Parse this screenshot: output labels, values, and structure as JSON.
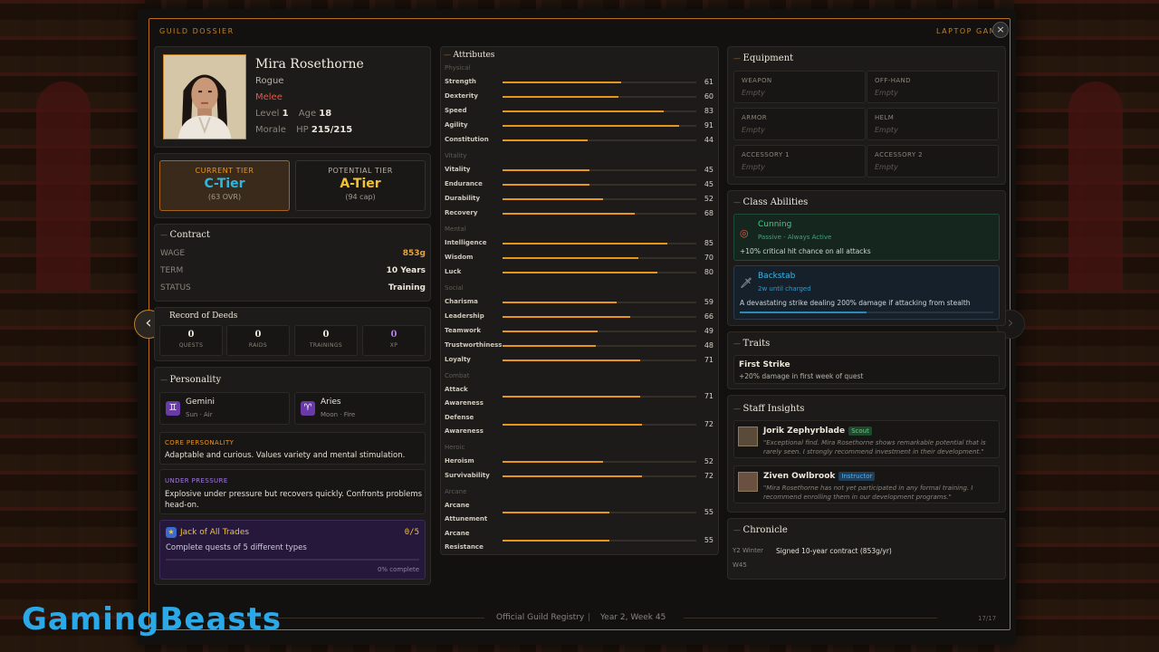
{
  "header": {
    "left": "GUILD DOSSIER",
    "right": "LAPTOP GAM",
    "close": "×"
  },
  "nav": {
    "prev": "‹",
    "next": "›"
  },
  "profile": {
    "name": "Mira Rosethorne",
    "class": "Rogue",
    "style": "Melee",
    "level_label": "Level",
    "level": "1",
    "age_label": "Age",
    "age": "18",
    "morale_label": "Morale",
    "hp_label": "HP",
    "hp": "215/215"
  },
  "tiers": {
    "current": {
      "label": "CURRENT TIER",
      "value": "C-Tier",
      "sub": "(63 OVR)"
    },
    "potential": {
      "label": "POTENTIAL TIER",
      "value": "A-Tier",
      "sub": "(94 cap)"
    }
  },
  "contract": {
    "title": "Contract",
    "rows": [
      {
        "label": "WAGE",
        "value": "853g"
      },
      {
        "label": "TERM",
        "value": "10 Years"
      },
      {
        "label": "STATUS",
        "value": "Training"
      }
    ]
  },
  "deeds": {
    "title": "Record of Deeds",
    "items": [
      {
        "value": "0",
        "label": "QUESTS"
      },
      {
        "value": "0",
        "label": "RAIDS"
      },
      {
        "value": "0",
        "label": "TRAININGS"
      },
      {
        "value": "0",
        "label": "XP"
      }
    ]
  },
  "personality": {
    "title": "Personality",
    "sun": {
      "icon": "♊",
      "name": "Gemini",
      "sub": "Sun · Air"
    },
    "moon": {
      "icon": "♈",
      "name": "Aries",
      "sub": "Moon · Fire"
    },
    "core_label": "CORE PERSONALITY",
    "core_text": "Adaptable and curious. Values variety and mental stimulation.",
    "pressure_label": "UNDER PRESSURE",
    "pressure_text_1": "Explosive under pressure but recovers quickly. Confronts problems",
    "pressure_text_2": "head-on.",
    "achievement": {
      "name": "Jack of All Trades",
      "count": "0/5",
      "desc": "Complete quests of 5 different types",
      "progress": 0,
      "progress_text": "0% complete"
    }
  },
  "attributes": {
    "title": "Attributes",
    "groups": [
      {
        "name": "Physical",
        "items": [
          {
            "name": "Strength",
            "value": 61
          },
          {
            "name": "Dexterity",
            "value": 60
          },
          {
            "name": "Speed",
            "value": 83
          },
          {
            "name": "Agility",
            "value": 91
          },
          {
            "name": "Constitution",
            "value": 44
          }
        ]
      },
      {
        "name": "Vitality",
        "items": [
          {
            "name": "Vitality",
            "value": 45
          },
          {
            "name": "Endurance",
            "value": 45
          },
          {
            "name": "Durability",
            "value": 52
          },
          {
            "name": "Recovery",
            "value": 68
          }
        ]
      },
      {
        "name": "Mental",
        "items": [
          {
            "name": "Intelligence",
            "value": 85
          },
          {
            "name": "Wisdom",
            "value": 70
          },
          {
            "name": "Luck",
            "value": 80
          }
        ]
      },
      {
        "name": "Social",
        "items": [
          {
            "name": "Charisma",
            "value": 59
          },
          {
            "name": "Leadership",
            "value": 66
          },
          {
            "name": "Teamwork",
            "value": 49
          },
          {
            "name": "Trustworthiness",
            "value": 48
          },
          {
            "name": "Loyalty",
            "value": 71
          }
        ]
      },
      {
        "name": "Combat",
        "items": [
          {
            "name": "Attack",
            "name2": "Awareness",
            "value": 71
          },
          {
            "name": "Defense",
            "name2": "Awareness",
            "value": 72
          }
        ]
      },
      {
        "name": "Heroic",
        "items": [
          {
            "name": "Heroism",
            "value": 52
          },
          {
            "name": "Survivability",
            "value": 72
          }
        ]
      },
      {
        "name": "Arcane",
        "items": [
          {
            "name": "Arcane",
            "name2": "Attunement",
            "value": 55
          },
          {
            "name": "Arcane",
            "name2": "Resistance",
            "value": 55
          }
        ]
      }
    ]
  },
  "equipment": {
    "title": "Equipment",
    "slots": [
      {
        "label": "WEAPON",
        "value": "Empty"
      },
      {
        "label": "OFF-HAND",
        "value": "Empty"
      },
      {
        "label": "ARMOR",
        "value": "Empty"
      },
      {
        "label": "HELM",
        "value": "Empty"
      },
      {
        "label": "ACCESSORY 1",
        "value": "Empty"
      },
      {
        "label": "ACCESSORY 2",
        "value": "Empty"
      }
    ]
  },
  "abilities": {
    "title": "Class Abilities",
    "cunning": {
      "name": "Cunning",
      "sub": "Passive - Always Active",
      "desc": "+10% critical hit chance on all attacks"
    },
    "backstab": {
      "name": "Backstab",
      "sub": "2w until charged",
      "desc": "A devastating strike dealing 200% damage if attacking from stealth",
      "charge": 0.5
    }
  },
  "traits": {
    "title": "Traits",
    "items": [
      {
        "name": "First Strike",
        "desc": "+20% damage in first week of quest"
      }
    ]
  },
  "insights": {
    "title": "Staff Insights",
    "items": [
      {
        "name": "Jorik Zephyrblade",
        "role": "Scout",
        "q1": "\"Exceptional find. Mira Rosethorne shows remarkable potential that is",
        "q2": "rarely seen. I strongly recommend investment in their development.\""
      },
      {
        "name": "Ziven Owlbrook",
        "role": "Instructor",
        "q1": "\"Mira Rosethorne has not yet participated in any formal training. I",
        "q2": "recommend enrolling them in our development programs.\""
      }
    ]
  },
  "chronicle": {
    "title": "Chronicle",
    "entries": [
      {
        "date1": "Y2 Winter",
        "date2": "W45",
        "text": "Signed 10-year contract (853g/yr)"
      }
    ]
  },
  "footer": {
    "registry": "Official Guild Registry",
    "sep": "|",
    "date": "Year 2, Week 45",
    "page": "17/17"
  },
  "watermark": "GamingBeasts",
  "colors": {
    "accent": "#e8951e",
    "tier_current": "#2fb7e0",
    "tier_potential": "#f2c230",
    "melee": "#e8564a"
  }
}
